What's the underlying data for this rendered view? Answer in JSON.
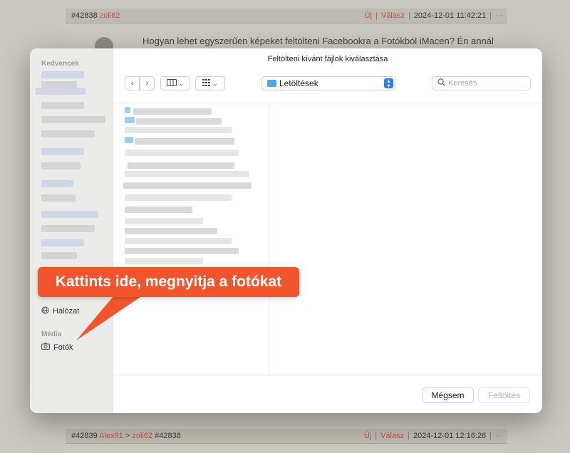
{
  "forum": {
    "post1": {
      "id": "#42838",
      "user": "zoli62",
      "reply_new": "Új",
      "reply": "Válasz",
      "timestamp": "2024-12-01 11:42:21",
      "more": "···",
      "text": "Hogyan lehet egyszerűen képeket feltölteni Facebookra a Fotókból iMacen? Én annál"
    },
    "post2": {
      "id": "#42839",
      "user": "Alex91",
      "arrow": ">",
      "reply_to_user": "zoli62",
      "reply_to_id": "#42838",
      "reply_new": "Új",
      "reply": "Válasz",
      "timestamp": "2024-12-01 12:16:26",
      "more": "···"
    }
  },
  "dialog": {
    "title": "Feltölteni kívánt fájlok kiválasztása",
    "location": "Letöltések",
    "search_placeholder": "Keresés",
    "cancel_label": "Mégsem",
    "upload_label": "Feltöltés",
    "sidebar": {
      "favorites_heading": "Kedvencek",
      "network_label": "Hálózat",
      "media_heading": "Média",
      "photos_label": "Fotók"
    }
  },
  "callout": {
    "text": "Kattints ide, megnyitja a fotókat",
    "color": "#f2552c"
  },
  "colors": {
    "accent": "#2f7cf6",
    "forum_link": "#c0504d"
  }
}
